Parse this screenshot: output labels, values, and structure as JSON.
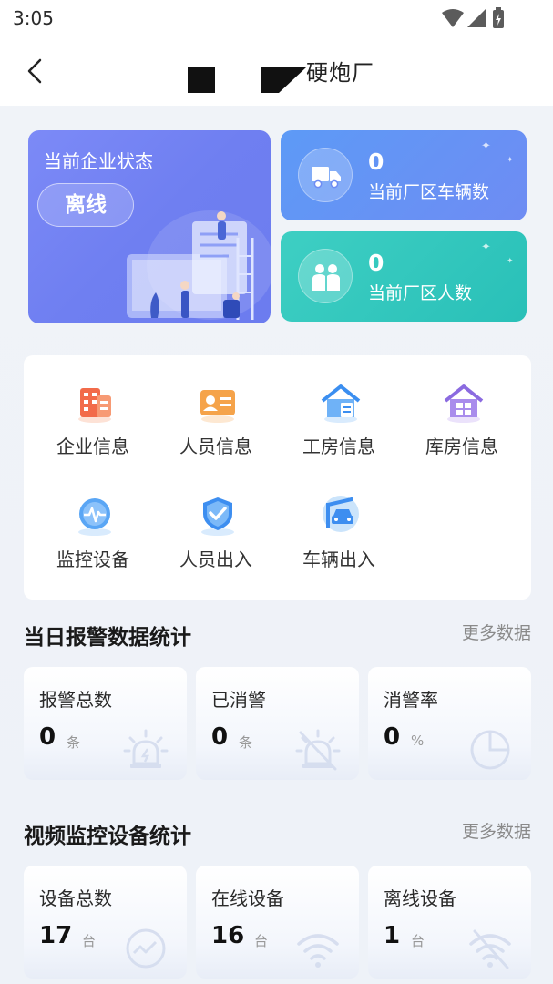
{
  "status_bar": {
    "time": "3:05"
  },
  "header": {
    "title": "硬炮厂"
  },
  "enterprise_status": {
    "label": "当前企业状态",
    "status": "离线"
  },
  "stats_cards": [
    {
      "value": "0",
      "label": "当前厂区车辆数",
      "icon": "truck-icon"
    },
    {
      "value": "0",
      "label": "当前厂区人数",
      "icon": "people-icon"
    }
  ],
  "menu": [
    {
      "label": "企业信息",
      "icon": "building-icon"
    },
    {
      "label": "人员信息",
      "icon": "id-card-icon"
    },
    {
      "label": "工房信息",
      "icon": "workshop-icon"
    },
    {
      "label": "库房信息",
      "icon": "warehouse-icon"
    },
    {
      "label": "监控设备",
      "icon": "monitor-icon"
    },
    {
      "label": "人员出入",
      "icon": "shield-check-icon"
    },
    {
      "label": "车辆出入",
      "icon": "vehicle-gate-icon"
    }
  ],
  "alarm_section": {
    "title": "当日报警数据统计",
    "more": "更多数据",
    "cards": [
      {
        "label": "报警总数",
        "value": "0",
        "unit": "条",
        "icon": "alarm-light-icon"
      },
      {
        "label": "已消警",
        "value": "0",
        "unit": "条",
        "icon": "alarm-off-icon"
      },
      {
        "label": "消警率",
        "value": "0",
        "unit": "%",
        "icon": "pie-icon"
      }
    ]
  },
  "video_section": {
    "title": "视频监控设备统计",
    "more": "更多数据",
    "cards": [
      {
        "label": "设备总数",
        "value": "17",
        "unit": "台",
        "icon": "pulse-icon"
      },
      {
        "label": "在线设备",
        "value": "16",
        "unit": "台",
        "icon": "wifi-icon"
      },
      {
        "label": "离线设备",
        "value": "1",
        "unit": "台",
        "icon": "wifi-off-icon"
      }
    ]
  },
  "colors": {
    "status_card": "#7381f2",
    "vehicle_card": "#6592f5",
    "people_card": "#33c8bd",
    "accent_orange": "#f0834e",
    "accent_blue": "#3d8ef0",
    "accent_purple": "#8b6be0"
  }
}
